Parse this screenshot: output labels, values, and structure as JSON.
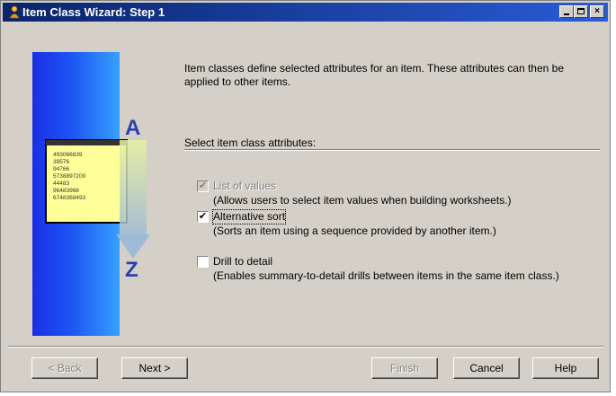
{
  "window": {
    "title": "Item Class Wizard: Step 1",
    "title_icon": "wizard-icon",
    "controls": {
      "minimize": "minimize-icon",
      "maximize": "maximize-icon",
      "close": "×"
    }
  },
  "illustration": {
    "letter_top": "A",
    "letter_bottom": "Z",
    "list_lines": [
      "493066839",
      "39576",
      "94766",
      "5738897209",
      "44483",
      "96483968",
      "6748368493"
    ]
  },
  "intro_text": "Item classes define selected attributes for an item.  These attributes can then be applied to other items.",
  "section_label": "Select item class attributes:",
  "options": [
    {
      "label": "List of values",
      "checked": true,
      "disabled": true,
      "description": "(Allows users to select item values when building worksheets.)"
    },
    {
      "label": "Alternative sort",
      "checked": true,
      "disabled": false,
      "description": "(Sorts an item using a sequence provided by another item.)"
    },
    {
      "label": "Drill to detail",
      "checked": false,
      "disabled": false,
      "description": "(Enables summary-to-detail drills between items in the same item class.)"
    }
  ],
  "buttons": {
    "back": "< Back",
    "next": "Next >",
    "finish": "Finish",
    "cancel": "Cancel",
    "help": "Help"
  },
  "colors": {
    "title_bar": "#0a246a",
    "dialog_bg": "#d4d0c8",
    "panel_blue": "#1d55f2"
  }
}
